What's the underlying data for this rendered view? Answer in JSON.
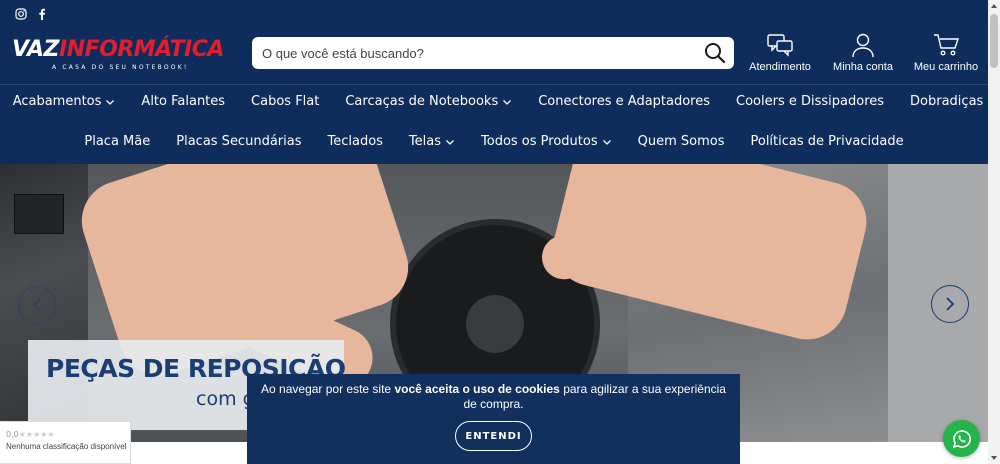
{
  "header": {
    "social": [
      {
        "icon": "instagram-icon"
      },
      {
        "icon": "facebook-icon"
      }
    ],
    "logo": {
      "main_a": "VAZ",
      "main_b": "INFORMÁTICA",
      "tagline": "A CASA DO SEU NOTEBOOK!"
    },
    "search": {
      "placeholder": "O que você está buscando?",
      "icon": "search-icon"
    },
    "actions": [
      {
        "label": "Atendimento",
        "icon": "chat-icon"
      },
      {
        "label": "Minha conta",
        "icon": "user-icon"
      },
      {
        "label": "Meu carrinho",
        "icon": "cart-icon"
      }
    ]
  },
  "nav": {
    "row1": [
      {
        "label": "Acabamentos",
        "dropdown": true
      },
      {
        "label": "Alto Falantes",
        "dropdown": false
      },
      {
        "label": "Cabos Flat",
        "dropdown": false
      },
      {
        "label": "Carcaças de Notebooks",
        "dropdown": true
      },
      {
        "label": "Conectores e Adaptadores",
        "dropdown": false
      },
      {
        "label": "Coolers e Dissipadores",
        "dropdown": false
      },
      {
        "label": "Dobradiças",
        "dropdown": false
      }
    ],
    "row2": [
      {
        "label": "Placa Mãe",
        "dropdown": false
      },
      {
        "label": "Placas Secundárias",
        "dropdown": false
      },
      {
        "label": "Teclados",
        "dropdown": false
      },
      {
        "label": "Telas",
        "dropdown": true
      },
      {
        "label": "Todos os Produtos",
        "dropdown": true
      },
      {
        "label": "Quem Somos",
        "dropdown": false
      },
      {
        "label": "Políticas de Privacidade",
        "dropdown": false
      }
    ]
  },
  "banner": {
    "title": "PEÇAS DE REPOSIÇÃO",
    "subtitle": "com garantia"
  },
  "rating": {
    "score": "0,0",
    "stars": "★★★★★",
    "text": "Nenhuma classificação disponível"
  },
  "cookie": {
    "text_a": "Ao navegar por este site ",
    "text_bold": "você aceita o uso de cookies",
    "text_b": " para agilizar a sua experiência de compra.",
    "button": "ENTENDI"
  },
  "colors": {
    "header_bg": "#0f2d5c",
    "brand_red": "#e31d2b",
    "promo_blue": "#1a3d73",
    "whatsapp_green": "#25b34b"
  }
}
